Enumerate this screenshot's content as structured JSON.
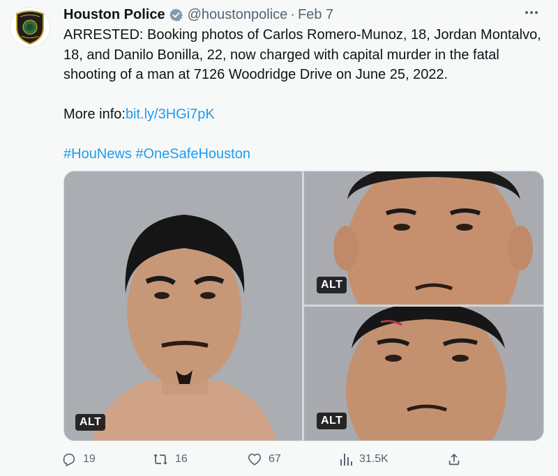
{
  "author": {
    "display_name": "Houston Police",
    "handle": "@houstonpolice",
    "separator": "·",
    "date": "Feb 7",
    "avatar_text_top": "HOUSTON",
    "avatar_text_bottom": "POLICE",
    "verified": true
  },
  "tweet": {
    "text": "ARRESTED: Booking photos of Carlos Romero-Munoz, 18, Jordan Montalvo, 18, and Danilo Bonilla, 22, now charged with capital murder in the fatal shooting of a man at 7126 Woodridge Drive on June 25, 2022.",
    "more_info_label": "More info:",
    "more_info_link": "bit.ly/3HGi7pK",
    "hashtags": "#HouNews #OneSafeHouston"
  },
  "media": {
    "alt_badge": "ALT",
    "tiles": [
      "booking-photo-1",
      "booking-photo-2",
      "booking-photo-3"
    ]
  },
  "actions": {
    "replies": "19",
    "retweets": "16",
    "likes": "67",
    "views": "31.5K"
  },
  "colors": {
    "link": "#1d9bf0",
    "verified": "#829aab",
    "secondary_text": "#536471",
    "background": "#f7f9f9"
  },
  "icons": {
    "more": "more-icon",
    "reply": "reply-icon",
    "retweet": "retweet-icon",
    "like": "heart-icon",
    "views": "views-icon",
    "share": "share-icon",
    "verified": "verified-badge-icon"
  }
}
